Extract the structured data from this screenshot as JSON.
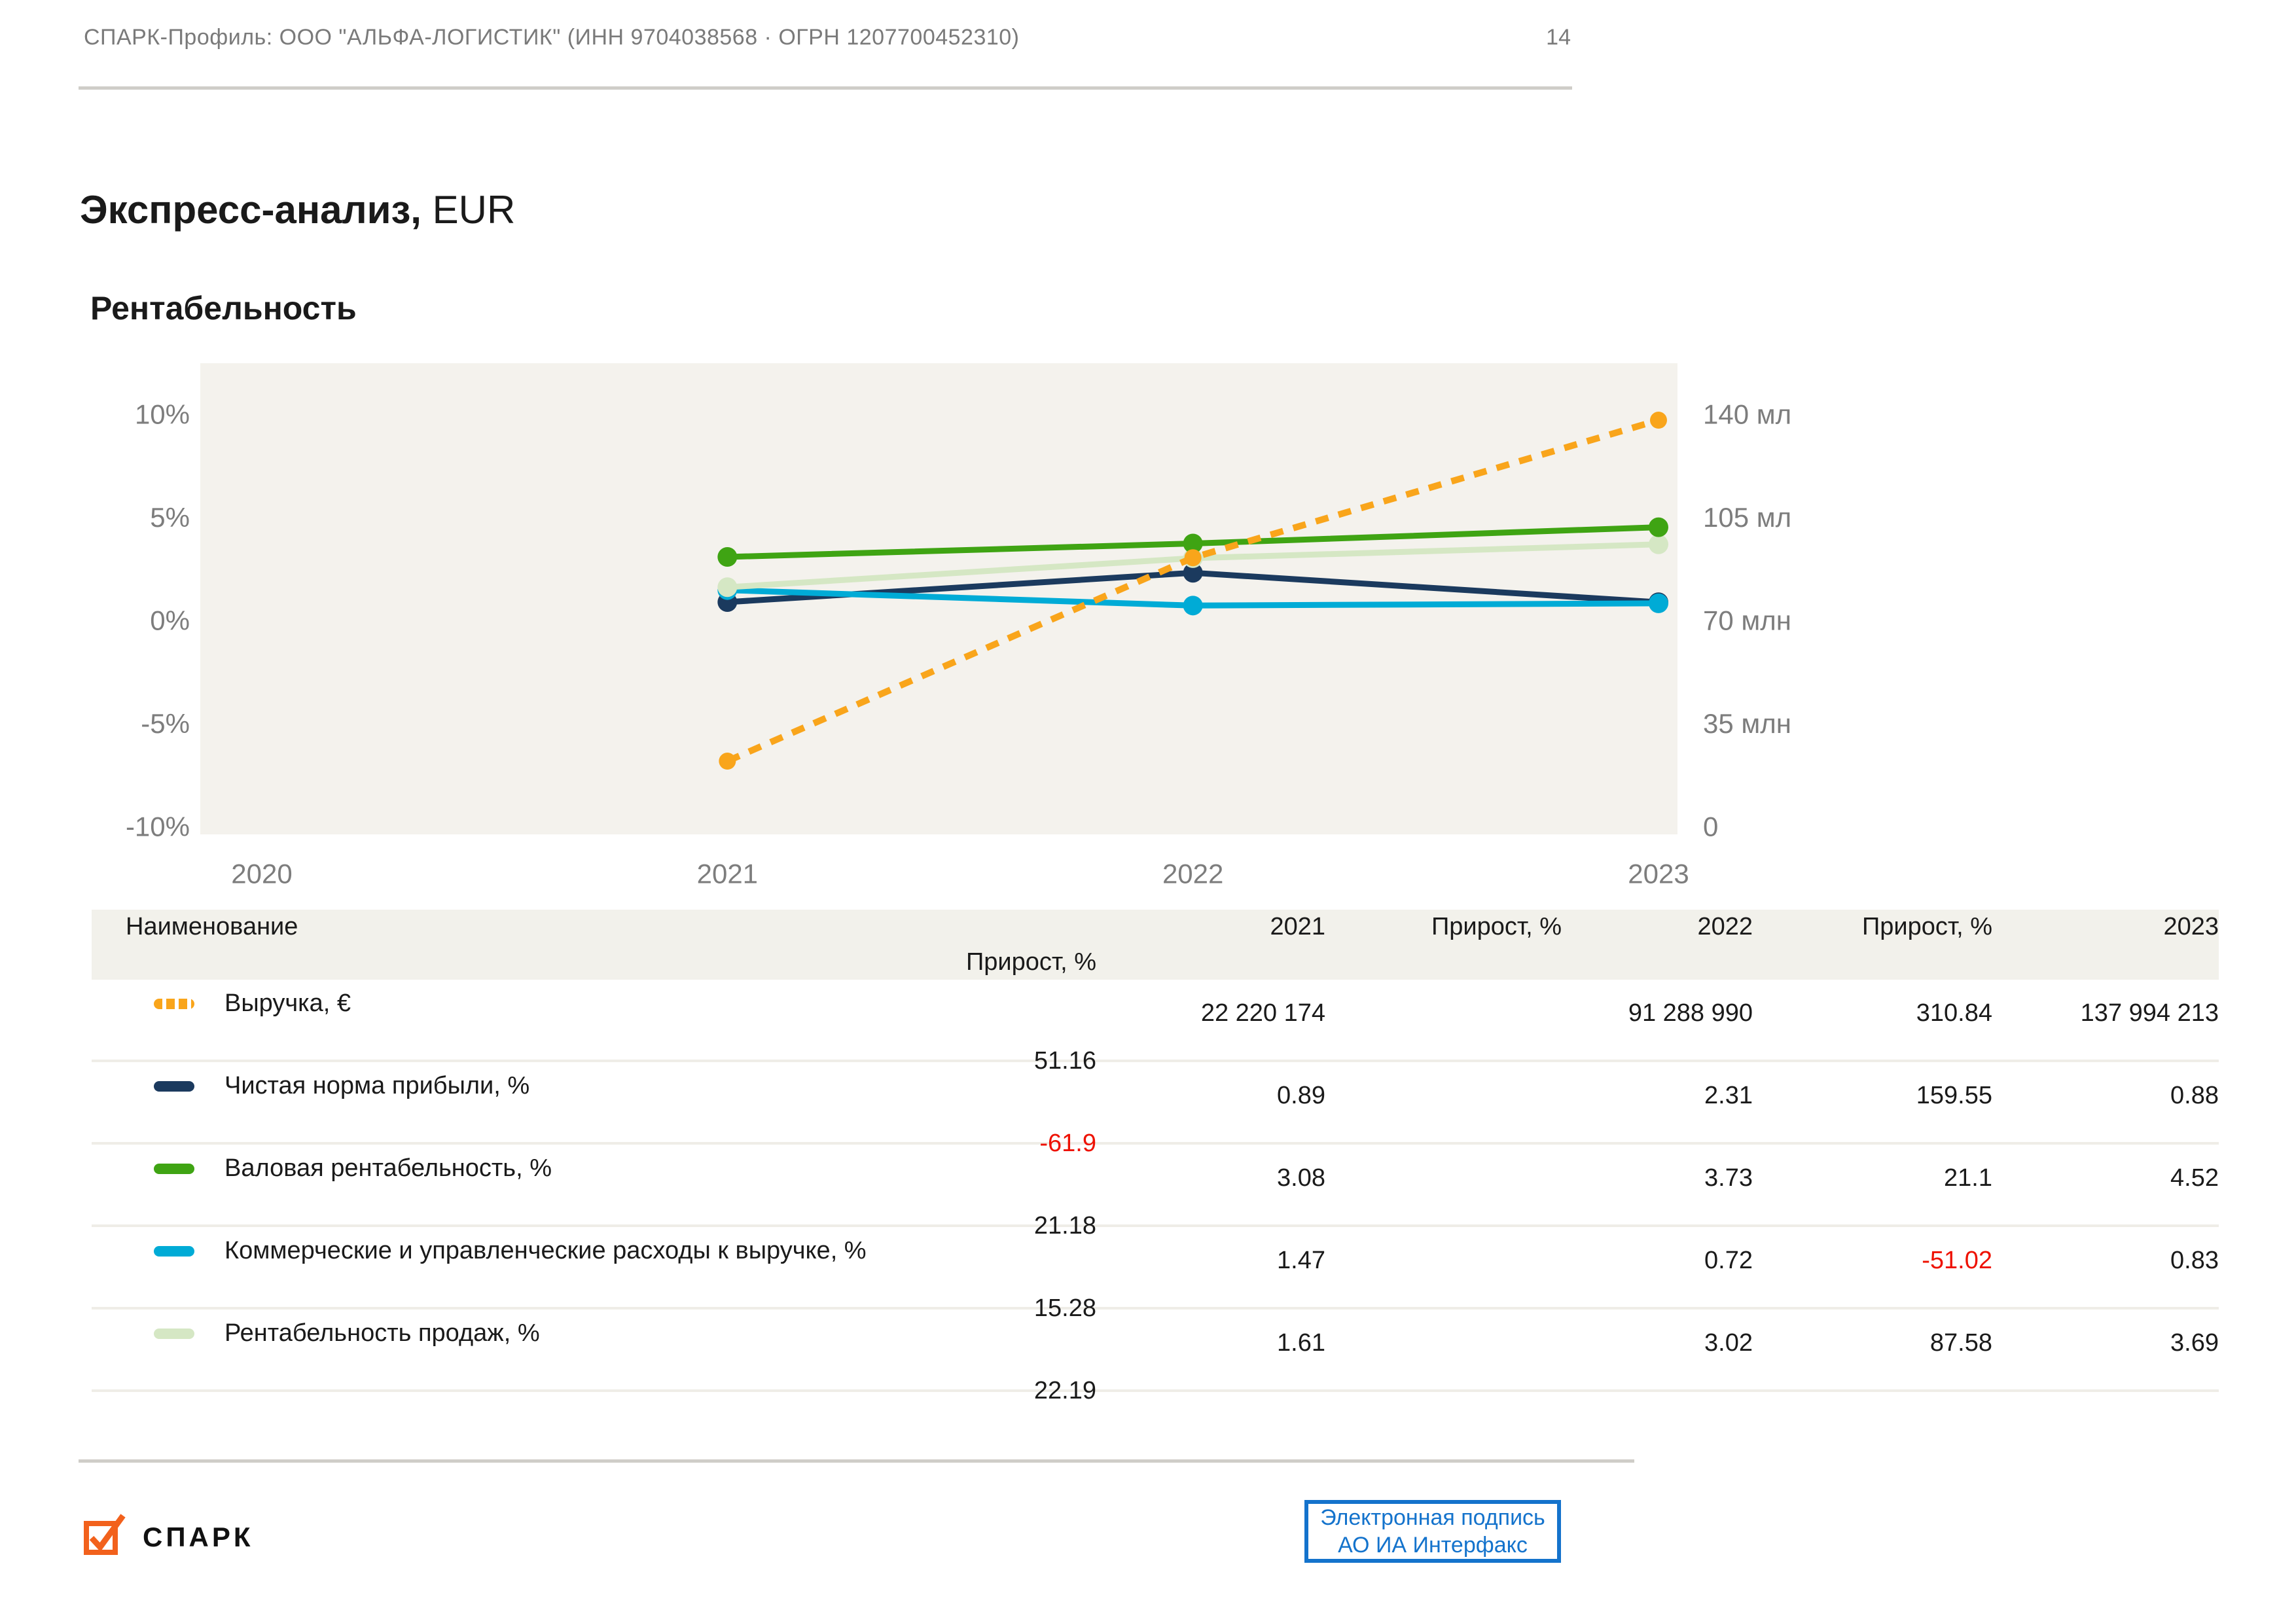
{
  "header": {
    "profile_line": "СПАРК-Профиль: ООО \"АЛЬФА-ЛОГИСТИК\" (ИНН 9704038568 · ОГРН 1207700452310)",
    "page_number": "14"
  },
  "title": {
    "main": "Экспресс-анализ,",
    "suffix": " EUR"
  },
  "section": {
    "title": "Рентабельность"
  },
  "colors": {
    "revenue_orange": "#f9a51b",
    "net_margin_navy": "#1b3a5e",
    "gross_margin_green": "#3fa413",
    "expenses_cyan": "#00abd6",
    "ros_light_green": "#d5e7c4",
    "negative_red": "#ee1100",
    "signature_blue": "#1473cc",
    "logo_orange": "#f2611c",
    "plot_background": "#f4f2ed",
    "axis_text_gray": "#7d7d7d",
    "rule_gray": "#cfcdc8"
  },
  "chart_data": {
    "type": "line",
    "title": "Рентабельность",
    "x": [
      2020,
      2021,
      2022,
      2023
    ],
    "grid": false,
    "legend_position": "table-below",
    "left_axis": {
      "unit": "%",
      "range": [
        -10,
        10
      ],
      "ticks": [
        "10%",
        "5%",
        "0%",
        "-5%",
        "-10%"
      ],
      "tick_values": [
        10,
        5,
        0,
        -5,
        -10
      ]
    },
    "right_axis": {
      "unit": "млн EUR",
      "range": [
        0,
        140
      ],
      "ticks": [
        "140 млн",
        "105 млн",
        "70 млн",
        "35 млн",
        "0"
      ],
      "tick_values": [
        140,
        105,
        70,
        35,
        0
      ]
    },
    "series": [
      {
        "name": "Выручка, €",
        "axis": "right",
        "style": "dashed",
        "color": "#f9a51b",
        "x": [
          2021,
          2022,
          2023
        ],
        "values_eur": [
          22220174,
          91288990,
          137994213
        ],
        "values_mln": [
          22.22,
          91.29,
          137.99
        ]
      },
      {
        "name": "Чистая норма прибыли, %",
        "axis": "left",
        "style": "solid",
        "color": "#1b3a5e",
        "x": [
          2021,
          2022,
          2023
        ],
        "values": [
          0.89,
          2.31,
          0.88
        ]
      },
      {
        "name": "Валовая рентабельность, %",
        "axis": "left",
        "style": "solid",
        "color": "#3fa413",
        "x": [
          2021,
          2022,
          2023
        ],
        "values": [
          3.08,
          3.73,
          4.52
        ]
      },
      {
        "name": "Коммерческие и управленческие расходы к выручке, %",
        "axis": "left",
        "style": "solid",
        "color": "#00abd6",
        "x": [
          2021,
          2022,
          2023
        ],
        "values": [
          1.47,
          0.72,
          0.83
        ]
      },
      {
        "name": "Рентабельность продаж, %",
        "axis": "left",
        "style": "solid",
        "color": "#d5e7c4",
        "x": [
          2021,
          2022,
          2023
        ],
        "values": [
          1.61,
          3.02,
          3.69
        ]
      }
    ]
  },
  "table": {
    "columns": [
      "Наименование",
      "2021",
      "Прирост, %",
      "2022",
      "Прирост, %",
      "2023",
      "Прирост, %"
    ],
    "rows": [
      {
        "name": "Выручка, €",
        "swatch": "#f9a51b",
        "dashed": true,
        "cells": [
          {
            "v": "22 220 174"
          },
          {
            "v": ""
          },
          {
            "v": "91 288 990"
          },
          {
            "v": "310.84"
          },
          {
            "v": "137 994 213"
          },
          {
            "v": "51.16"
          }
        ]
      },
      {
        "name": "Чистая норма прибыли, %",
        "swatch": "#1b3a5e",
        "dashed": false,
        "cells": [
          {
            "v": "0.89"
          },
          {
            "v": ""
          },
          {
            "v": "2.31"
          },
          {
            "v": "159.55"
          },
          {
            "v": "0.88"
          },
          {
            "v": "-61.9",
            "neg": true
          }
        ]
      },
      {
        "name": "Валовая рентабельность, %",
        "swatch": "#3fa413",
        "dashed": false,
        "cells": [
          {
            "v": "3.08"
          },
          {
            "v": ""
          },
          {
            "v": "3.73"
          },
          {
            "v": "21.1"
          },
          {
            "v": "4.52"
          },
          {
            "v": "21.18"
          }
        ]
      },
      {
        "name": "Коммерческие и управленческие расходы к выручке, %",
        "swatch": "#00abd6",
        "dashed": false,
        "cells": [
          {
            "v": "1.47"
          },
          {
            "v": ""
          },
          {
            "v": "0.72"
          },
          {
            "v": "-51.02",
            "neg": true
          },
          {
            "v": "0.83"
          },
          {
            "v": "15.28"
          }
        ]
      },
      {
        "name": "Рентабельность продаж, %",
        "swatch": "#d5e7c4",
        "dashed": false,
        "cells": [
          {
            "v": "1.61"
          },
          {
            "v": ""
          },
          {
            "v": "3.02"
          },
          {
            "v": "87.58"
          },
          {
            "v": "3.69"
          },
          {
            "v": "22.19"
          }
        ]
      }
    ]
  },
  "footer": {
    "logo_text": "СПАРК",
    "signature": {
      "line1": "Электронная подпись",
      "line2": "АО ИА Интерфакс"
    }
  }
}
